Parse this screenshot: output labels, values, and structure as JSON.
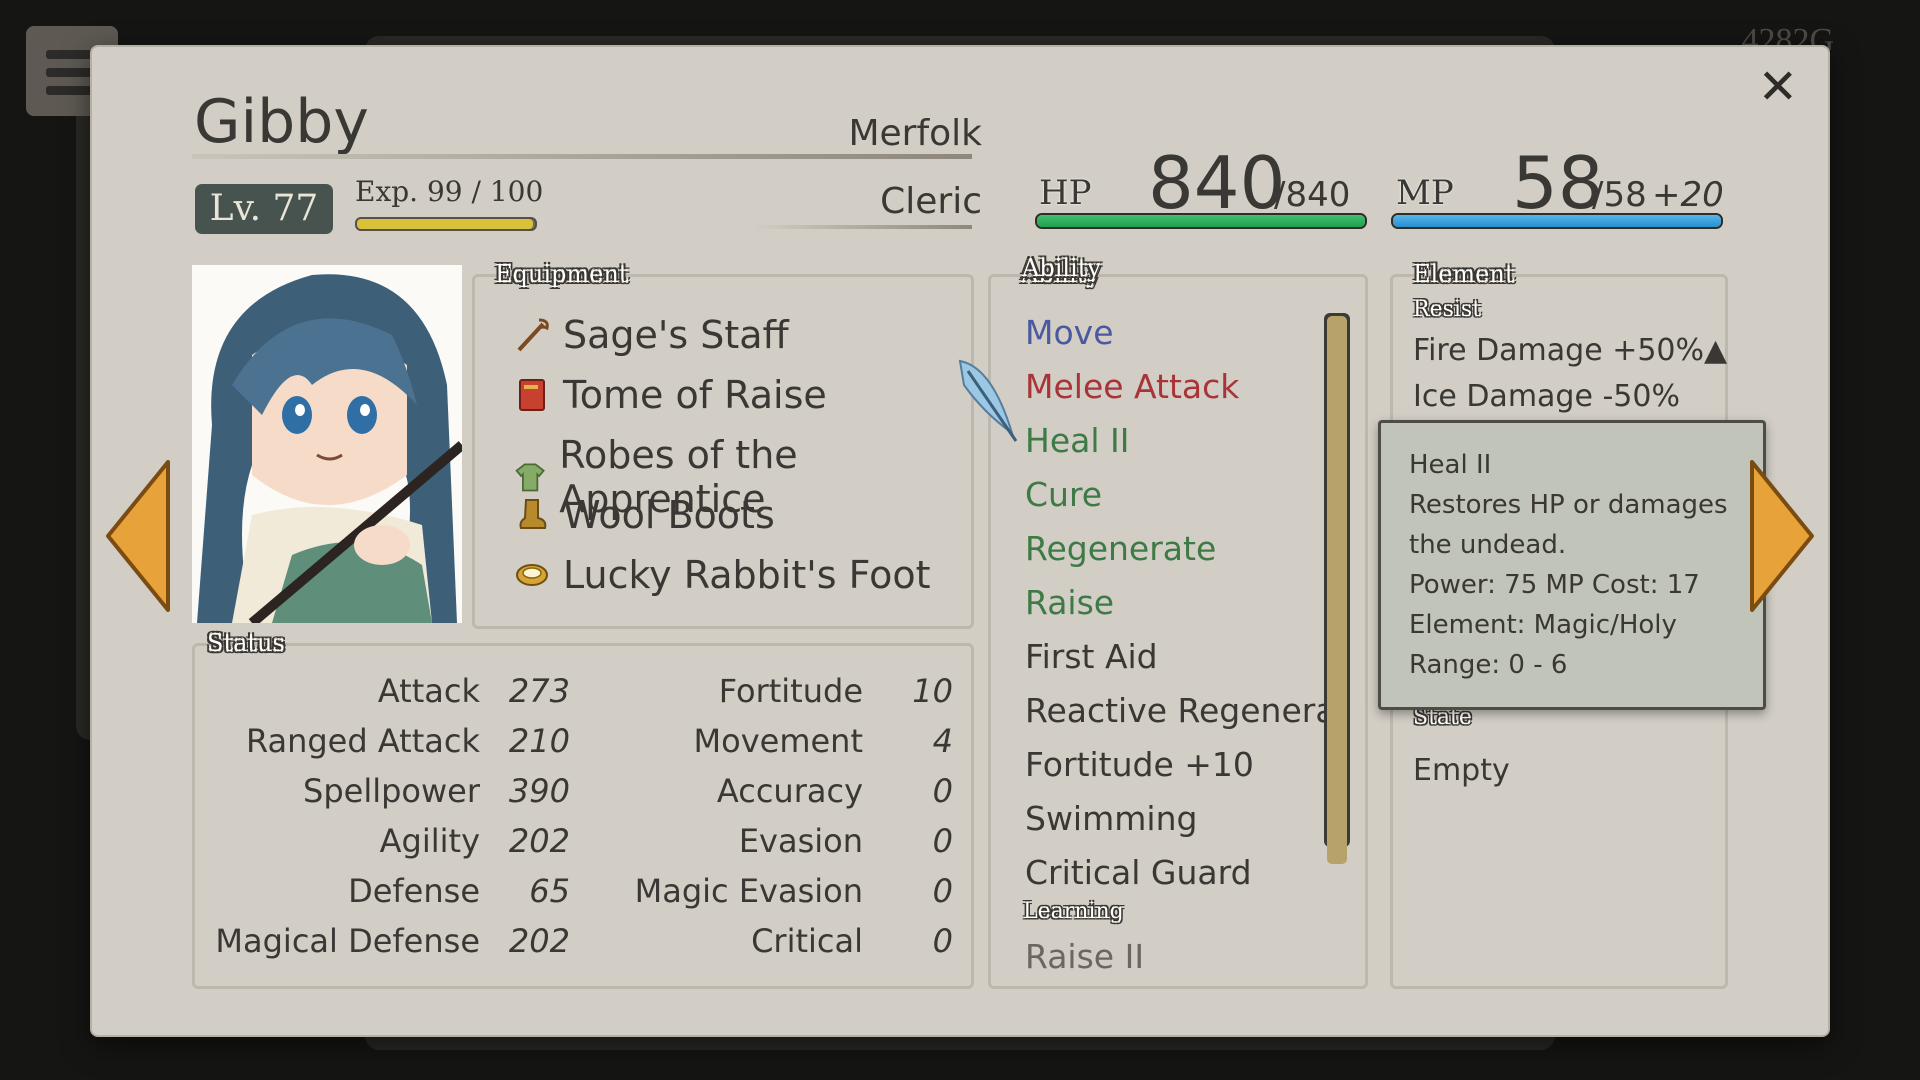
{
  "gold": "4282G",
  "character": {
    "name": "Gibby",
    "race": "Merfolk",
    "class": "Cleric",
    "level": "Lv. 77",
    "exp_label": "Exp. 99 / 100",
    "exp_fraction": 0.99
  },
  "hp": {
    "label": "HP",
    "current": "840",
    "max": "/840",
    "fraction": 1.0
  },
  "mp": {
    "label": "MP",
    "current": "58",
    "max": "/58",
    "bonus": "+20",
    "fraction": 1.0
  },
  "equipment": {
    "title": "Equipment",
    "items": [
      {
        "label": "Sage's Staff",
        "icon": "staff-icon"
      },
      {
        "label": "Tome of Raise",
        "icon": "book-icon"
      },
      {
        "label": "Robes of the Apprentice",
        "icon": "robe-icon"
      },
      {
        "label": "Wool Boots",
        "icon": "boot-icon"
      },
      {
        "label": "Lucky Rabbit's Foot",
        "icon": "ring-icon"
      }
    ]
  },
  "status": {
    "title": "Status",
    "left": [
      {
        "label": "Attack",
        "value": "273"
      },
      {
        "label": "Ranged Attack",
        "value": "210"
      },
      {
        "label": "Spellpower",
        "value": "390"
      },
      {
        "label": "Agility",
        "value": "202"
      },
      {
        "label": "Defense",
        "value": "65"
      },
      {
        "label": "Magical Defense",
        "value": "202"
      }
    ],
    "right": [
      {
        "label": "Fortitude",
        "value": "10"
      },
      {
        "label": "Movement",
        "value": "4"
      },
      {
        "label": "Accuracy",
        "value": "0"
      },
      {
        "label": "Evasion",
        "value": "0"
      },
      {
        "label": "Magic Evasion",
        "value": "0"
      },
      {
        "label": "Critical",
        "value": "0"
      }
    ]
  },
  "ability": {
    "title": "Ability",
    "items": [
      {
        "label": "Move",
        "color": "#4a59a0"
      },
      {
        "label": "Melee Attack",
        "color": "#a8343a"
      },
      {
        "label": "Heal II",
        "color": "#3d7a45"
      },
      {
        "label": "Cure",
        "color": "#3d7a45"
      },
      {
        "label": "Regenerate",
        "color": "#3d7a45"
      },
      {
        "label": "Raise",
        "color": "#3d7a45"
      },
      {
        "label": "First Aid",
        "color": "#3a3834"
      },
      {
        "label": "Reactive Regenerat",
        "color": "#3a3834"
      },
      {
        "label": "Fortitude +10",
        "color": "#3a3834"
      },
      {
        "label": "Swimming",
        "color": "#3a3834"
      },
      {
        "label": "Critical Guard",
        "color": "#3a3834"
      }
    ],
    "learning_title": "Learning",
    "learning_items": [
      {
        "label": "Raise II"
      }
    ]
  },
  "element": {
    "title": "Element",
    "resist_title": "Resist",
    "resist_items": [
      "Fire Damage +50%",
      "Ice Damage -50%"
    ],
    "state_title": "State",
    "state_value": "Empty"
  },
  "tooltip": {
    "lines": [
      "Heal II",
      "Restores HP or damages",
      "the undead.",
      "Power: 75  MP Cost: 17",
      "Element: Magic/Holy",
      "Range: 0 - 6"
    ]
  },
  "colors": {
    "panel": "#d2cec5",
    "hp": "#2fb05e",
    "mp": "#3a9fdc",
    "exp": "#d9c23a",
    "arrow": "#e8a23a"
  }
}
